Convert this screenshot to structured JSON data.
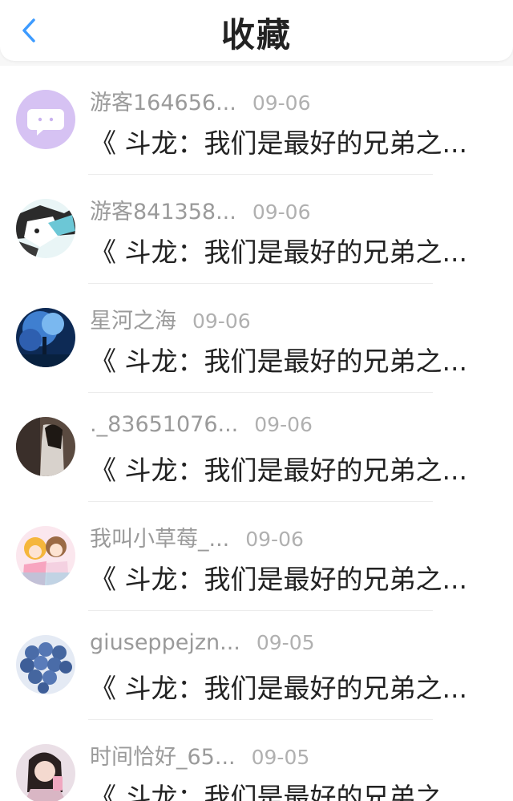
{
  "header": {
    "title": "收藏",
    "back_icon": "chevron-left-icon",
    "accent": "#3d9bff"
  },
  "items": [
    {
      "user": "游客164656...",
      "date": "09-06",
      "work": "《 斗龙：我们是最好的兄弟之...",
      "avatar": "chat-bubble-icon"
    },
    {
      "user": "游客841358...",
      "date": "09-06",
      "work": "《 斗龙：我们是最好的兄弟之...",
      "avatar": "anime-boy-avatar"
    },
    {
      "user": "星河之海",
      "date": "09-06",
      "work": "《 斗龙：我们是最好的兄弟之...",
      "avatar": "blue-tree-avatar"
    },
    {
      "user": "._83651076...",
      "date": "09-06",
      "work": "《 斗龙：我们是最好的兄弟之...",
      "avatar": "girl-photo-avatar"
    },
    {
      "user": "我叫小草莓_...",
      "date": "09-06",
      "work": "《 斗龙：我们是最好的兄弟之...",
      "avatar": "anime-girls-avatar"
    },
    {
      "user": "giuseppejzn...",
      "date": "09-05",
      "work": "《 斗龙：我们是最好的兄弟之...",
      "avatar": "blue-balls-avatar"
    },
    {
      "user": "时间恰好_65...",
      "date": "09-05",
      "work": "《 斗龙：我们是最好的兄弟之...",
      "avatar": "selfie-avatar"
    }
  ]
}
